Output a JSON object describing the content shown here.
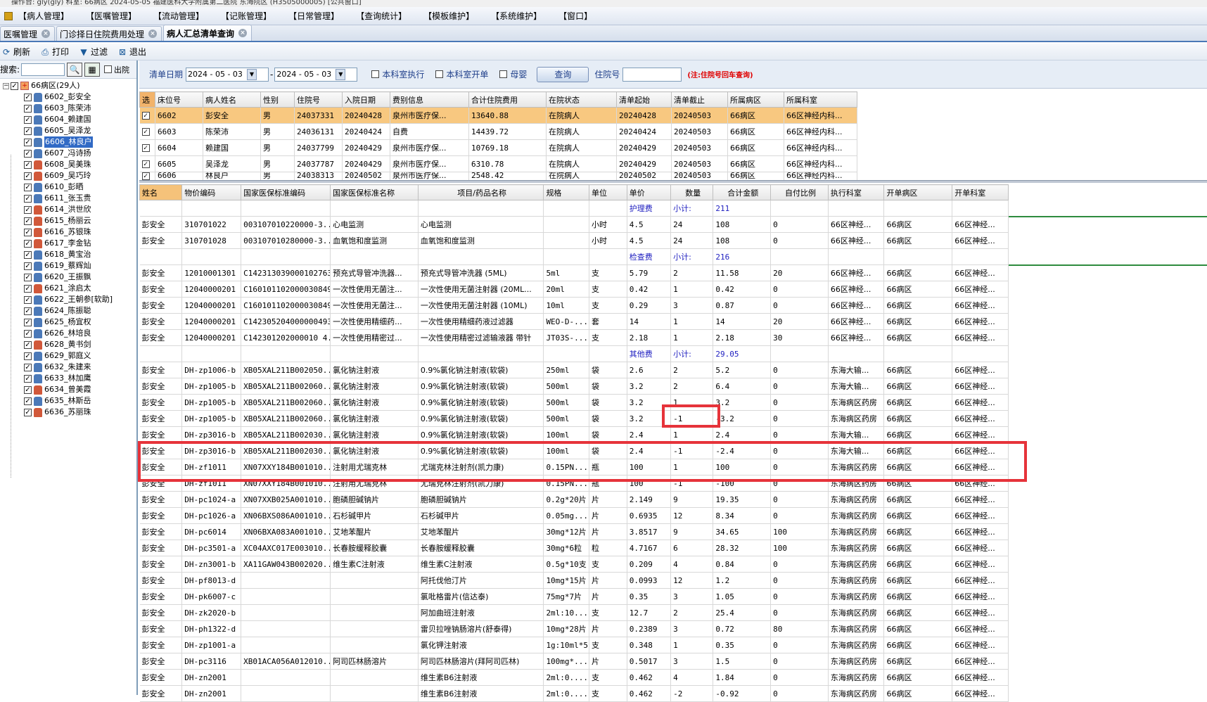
{
  "window": {
    "title_fragment": "操作台: gly(gly) 科室: 66病区 2024-05-05 福建医科大学附属第二医院 东海院区 (H3505000005) [公共窗口]"
  },
  "menu": [
    "【病人管理】",
    "【医嘱管理】",
    "【流动管理】",
    "【记账管理】",
    "【日常管理】",
    "【查询统计】",
    "【模板维护】",
    "【系统维护】",
    "【窗口】"
  ],
  "tabs": [
    {
      "label": "医嘱管理",
      "active": false
    },
    {
      "label": "门诊择日住院费用处理",
      "active": false
    },
    {
      "label": "病人汇总清单查询",
      "active": true
    }
  ],
  "toolbar": [
    {
      "icon": "refresh-icon",
      "label": "刷新"
    },
    {
      "icon": "print-icon",
      "label": "打印"
    },
    {
      "icon": "filter-icon",
      "label": "过滤"
    },
    {
      "icon": "exit-icon",
      "label": "退出"
    }
  ],
  "left": {
    "search_label": "搜索:",
    "search_value": "",
    "discharged_label": "出院",
    "root": "66病区(29人)",
    "patients": [
      "6602_彭安全",
      "6603_陈荣沛",
      "6604_赖建国",
      "6605_吴泽龙",
      "6606_林良户",
      "6607_冯诗扬",
      "6608_吴美珠",
      "6609_吴巧玲",
      "6610_彭晒",
      "6611_张玉贵",
      "6614_洪世欣",
      "6615_杨丽云",
      "6616_苏银珠",
      "6617_李金钻",
      "6618_黄宝治",
      "6619_蔡辉灿",
      "6620_王振飘",
      "6621_涂启太",
      "6622_王朝参[软助]",
      "6624_陈振聪",
      "6625_杨宜权",
      "6626_林培良",
      "6628_黄书剑",
      "6629_郭庭义",
      "6632_朱建来",
      "6633_林加鹰",
      "6634_曾美霞",
      "6635_林斯岳",
      "6636_苏丽珠"
    ],
    "female_indices": [
      6,
      7,
      10,
      11,
      12,
      13,
      17,
      22,
      26,
      28
    ],
    "selected_index": 4
  },
  "filter": {
    "date_label": "清单日期",
    "date_from": "2024 - 05 - 03",
    "dash": "-",
    "date_to": "2024 - 05 - 03",
    "dept_exec": "本科室执行",
    "dept_order": "本科室开单",
    "mother_baby": "母婴",
    "query_button": "查询",
    "inpatient_no_label": "住院号",
    "inpatient_no_value": "",
    "note": "(注:住院号回车查询)"
  },
  "patient_table": {
    "columns": [
      "选",
      "床位号",
      "病人姓名",
      "性别",
      "住院号",
      "入院日期",
      "费别信息",
      "合计住院费用",
      "在院状态",
      "清单起始",
      "清单截止",
      "所属病区",
      "所属科室"
    ],
    "rows": [
      [
        "✓",
        "6602",
        "彭安全",
        "男",
        "24037331",
        "20240428",
        "泉州市医疗保...",
        "13640.88",
        "在院病人",
        "20240428",
        "20240503",
        "66病区",
        "66区神经内科..."
      ],
      [
        "✓",
        "6603",
        "陈荣沛",
        "男",
        "24036131",
        "20240424",
        "自费",
        "14439.72",
        "在院病人",
        "20240424",
        "20240503",
        "66病区",
        "66区神经内科..."
      ],
      [
        "✓",
        "6604",
        "赖建国",
        "男",
        "24037799",
        "20240429",
        "泉州市医疗保...",
        "10769.18",
        "在院病人",
        "20240429",
        "20240503",
        "66病区",
        "66区神经内科..."
      ],
      [
        "✓",
        "6605",
        "吴泽龙",
        "男",
        "24037787",
        "20240429",
        "泉州市医疗保...",
        "6310.78",
        "在院病人",
        "20240429",
        "20240503",
        "66病区",
        "66区神经内科..."
      ],
      [
        "✓",
        "6606",
        "林良户",
        "男",
        "24038313",
        "20240502",
        "泉州市医疗保...",
        "2548.42",
        "在院病人",
        "20240502",
        "20240503",
        "66病区",
        "66区神经内科..."
      ]
    ]
  },
  "detail_table": {
    "columns": [
      "姓名",
      "物价编码",
      "国家医保标准编码",
      "国家医保标准名称",
      "项目/药品名称",
      "规格",
      "单位",
      "单价",
      "数量",
      "合计金额",
      "自付比例",
      "执行科室",
      "开单病区",
      "开单科室"
    ],
    "rows": [
      {
        "type": "sub",
        "cat": "护理费",
        "label": "小计:",
        "total": "211"
      },
      {
        "type": "row",
        "c": [
          "彭安全",
          "310701022",
          "003107010220000-3...",
          "心电监测",
          "心电监测",
          "",
          "小时",
          "4.5",
          "24",
          "108",
          "0",
          "66区神经...",
          "66病区",
          "66区神经..."
        ]
      },
      {
        "type": "row",
        "c": [
          "彭安全",
          "310701028",
          "003107010280000-3...",
          "血氧饱和度监测",
          "血氧饱和度监测",
          "",
          "小时",
          "4.5",
          "24",
          "108",
          "0",
          "66区神经...",
          "66病区",
          "66区神经..."
        ]
      },
      {
        "type": "sub",
        "cat": "检查费",
        "label": "小计:",
        "total": "216"
      },
      {
        "type": "row",
        "c": [
          "彭安全",
          "12010001301",
          "C142313039000102763",
          "预充式导管冲洗器...",
          "预充式导管冲洗器 (5ML)",
          "5ml",
          "支",
          "5.79",
          "2",
          "11.58",
          "20",
          "66区神经...",
          "66病区",
          "66区神经..."
        ]
      },
      {
        "type": "row",
        "c": [
          "彭安全",
          "12040000201",
          "C1601011020000308496",
          "一次性使用无菌注...",
          "一次性使用无菌注射器 (20ML...",
          "20ml",
          "支",
          "0.42",
          "1",
          "0.42",
          "0",
          "66区神经...",
          "66病区",
          "66区神经..."
        ]
      },
      {
        "type": "row",
        "c": [
          "彭安全",
          "12040000201",
          "C1601011020000308496",
          "一次性使用无菌注...",
          "一次性使用无菌注射器 (10ML)",
          "10ml",
          "支",
          "0.29",
          "3",
          "0.87",
          "0",
          "66区神经...",
          "66病区",
          "66区神经..."
        ]
      },
      {
        "type": "row",
        "c": [
          "彭安全",
          "12040000201",
          "C1423052040000004935",
          "一次性使用精细药...",
          "一次性使用精细药液过滤器",
          "WEO-D-...",
          "套",
          "14",
          "1",
          "14",
          "20",
          "66区神经...",
          "66病区",
          "66区神经..."
        ]
      },
      {
        "type": "row",
        "c": [
          "彭安全",
          "12040000201",
          "C142301202000010 4...",
          "一次性使用精密过...",
          "一次性使用精密过滤输液器 带针",
          "JT03S-...",
          "支",
          "2.18",
          "1",
          "2.18",
          "30",
          "66区神经...",
          "66病区",
          "66区神经..."
        ]
      },
      {
        "type": "sub",
        "cat": "其他费",
        "label": "小计:",
        "total": "29.05"
      },
      {
        "type": "row",
        "c": [
          "彭安全",
          "DH-zp1006-b",
          "XB05XAL211B002050...",
          "氯化钠注射液",
          "0.9%氯化钠注射液(软袋)",
          "250ml",
          "袋",
          "2.6",
          "2",
          "5.2",
          "0",
          "东海大输...",
          "66病区",
          "66区神经..."
        ]
      },
      {
        "type": "row",
        "c": [
          "彭安全",
          "DH-zp1005-b",
          "XB05XAL211B002060...",
          "氯化钠注射液",
          "0.9%氯化钠注射液(软袋)",
          "500ml",
          "袋",
          "3.2",
          "2",
          "6.4",
          "0",
          "东海大输...",
          "66病区",
          "66区神经..."
        ]
      },
      {
        "type": "row",
        "c": [
          "彭安全",
          "DH-zp1005-b",
          "XB05XAL211B002060...",
          "氯化钠注射液",
          "0.9%氯化钠注射液(软袋)",
          "500ml",
          "袋",
          "3.2",
          "1",
          "3.2",
          "0",
          "东海病区药房",
          "66病区",
          "66区神经..."
        ]
      },
      {
        "type": "row",
        "c": [
          "彭安全",
          "DH-zp1005-b",
          "XB05XAL211B002060...",
          "氯化钠注射液",
          "0.9%氯化钠注射液(软袋)",
          "500ml",
          "袋",
          "3.2",
          "-1",
          "-3.2",
          "0",
          "东海病区药房",
          "66病区",
          "66区神经..."
        ]
      },
      {
        "type": "row",
        "c": [
          "彭安全",
          "DH-zp3016-b",
          "XB05XAL211B002030...",
          "氯化钠注射液",
          "0.9%氯化钠注射液(软袋)",
          "100ml",
          "袋",
          "2.4",
          "1",
          "2.4",
          "0",
          "东海大输...",
          "66病区",
          "66区神经..."
        ]
      },
      {
        "type": "row",
        "c": [
          "彭安全",
          "DH-zp3016-b",
          "XB05XAL211B002030...",
          "氯化钠注射液",
          "0.9%氯化钠注射液(软袋)",
          "100ml",
          "袋",
          "2.4",
          "-1",
          "-2.4",
          "0",
          "东海大输...",
          "66病区",
          "66区神经..."
        ]
      },
      {
        "type": "row",
        "c": [
          "彭安全",
          "DH-zf1011",
          "XN07XXY184B001010...",
          "注射用尤瑞克林",
          "尤瑞克林注射剂(凯力康)",
          "0.15PN...",
          "瓶",
          "100",
          "1",
          "100",
          "0",
          "东海病区药房",
          "66病区",
          "66区神经..."
        ]
      },
      {
        "type": "row",
        "c": [
          "彭安全",
          "DH-zf1011",
          "XN07XXY184B001010...",
          "注射用尤瑞克林",
          "尤瑞克林注射剂(凯力康)",
          "0.15PN...",
          "瓶",
          "100",
          "-1",
          "-100",
          "0",
          "东海病区药房",
          "66病区",
          "66区神经..."
        ]
      },
      {
        "type": "row",
        "c": [
          "彭安全",
          "DH-pc1024-a",
          "XN07XXB025A001010...",
          "胞磷胆碱钠片",
          "胞磷胆碱钠片",
          "0.2g*20片",
          "片",
          "2.149",
          "9",
          "19.35",
          "0",
          "东海病区药房",
          "66病区",
          "66区神经..."
        ]
      },
      {
        "type": "row",
        "c": [
          "彭安全",
          "DH-pc1026-a",
          "XN06BXS086A001010...",
          "石杉碱甲片",
          "石杉碱甲片",
          "0.05mg...",
          "片",
          "0.6935",
          "12",
          "8.34",
          "0",
          "东海病区药房",
          "66病区",
          "66区神经..."
        ]
      },
      {
        "type": "row",
        "c": [
          "彭安全",
          "DH-pc6014",
          "XN06BXA083A001010...",
          "艾地苯醌片",
          "艾地苯醌片",
          "30mg*12片",
          "片",
          "3.8517",
          "9",
          "34.65",
          "100",
          "东海病区药房",
          "66病区",
          "66区神经..."
        ]
      },
      {
        "type": "row",
        "c": [
          "彭安全",
          "DH-pc3501-a",
          "XC04AXC017E003010...",
          "长春胺缓释胶囊",
          "长春胺缓释胶囊",
          "30mg*6粒",
          "粒",
          "4.7167",
          "6",
          "28.32",
          "100",
          "东海病区药房",
          "66病区",
          "66区神经..."
        ]
      },
      {
        "type": "row",
        "c": [
          "彭安全",
          "DH-zn3001-b",
          "XA11GAW043B002020...",
          "维生素C注射液",
          "维生素C注射液",
          "0.5g*10支",
          "支",
          "0.209",
          "4",
          "0.84",
          "0",
          "东海病区药房",
          "66病区",
          "66区神经..."
        ]
      },
      {
        "type": "row",
        "c": [
          "彭安全",
          "DH-pf8013-d",
          "",
          "",
          "阿托伐他汀片",
          "10mg*15片",
          "片",
          "0.0993",
          "12",
          "1.2",
          "0",
          "东海病区药房",
          "66病区",
          "66区神经..."
        ]
      },
      {
        "type": "row",
        "c": [
          "彭安全",
          "DH-pk6007-c",
          "",
          "",
          "氯吡格雷片(信达泰)",
          "75mg*7片",
          "片",
          "0.35",
          "3",
          "1.05",
          "0",
          "东海病区药房",
          "66病区",
          "66区神经..."
        ]
      },
      {
        "type": "row",
        "c": [
          "彭安全",
          "DH-zk2020-b",
          "",
          "",
          "阿加曲班注射液",
          "2ml:10...",
          "支",
          "12.7",
          "2",
          "25.4",
          "0",
          "东海病区药房",
          "66病区",
          "66区神经..."
        ]
      },
      {
        "type": "row",
        "c": [
          "彭安全",
          "DH-ph1322-d",
          "",
          "",
          "雷贝拉唑钠肠溶片(舒泰得)",
          "10mg*28片",
          "片",
          "0.2389",
          "3",
          "0.72",
          "80",
          "东海病区药房",
          "66病区",
          "66区神经..."
        ]
      },
      {
        "type": "row",
        "c": [
          "彭安全",
          "DH-zp1001-a",
          "",
          "",
          "氯化钾注射液",
          "1g:10ml*5",
          "支",
          "0.348",
          "1",
          "0.35",
          "0",
          "东海病区药房",
          "66病区",
          "66区神经..."
        ]
      },
      {
        "type": "row",
        "c": [
          "彭安全",
          "DH-pc3116",
          "XB01ACA056A012010...",
          "阿司匹林肠溶片",
          "阿司匹林肠溶片(拜阿司匹林)",
          "100mg*...",
          "片",
          "0.5017",
          "3",
          "1.5",
          "0",
          "东海病区药房",
          "66病区",
          "66区神经..."
        ]
      },
      {
        "type": "row",
        "c": [
          "彭安全",
          "DH-zn2001",
          "",
          "",
          "维生素B6注射液",
          "2ml:0....",
          "支",
          "0.462",
          "4",
          "1.84",
          "0",
          "东海病区药房",
          "66病区",
          "66区神经..."
        ]
      },
      {
        "type": "row",
        "c": [
          "彭安全",
          "DH-zn2001",
          "",
          "",
          "维生素B6注射液",
          "2ml:0....",
          "支",
          "0.462",
          "-2",
          "-0.92",
          "0",
          "东海病区药房",
          "66病区",
          "66区神经..."
        ]
      }
    ]
  },
  "colors": {
    "highlight_row": "#f8c880",
    "subtotal_text": "#2020c0",
    "annotation_red": "#e6333a",
    "group_line": "#2e8b3e"
  }
}
